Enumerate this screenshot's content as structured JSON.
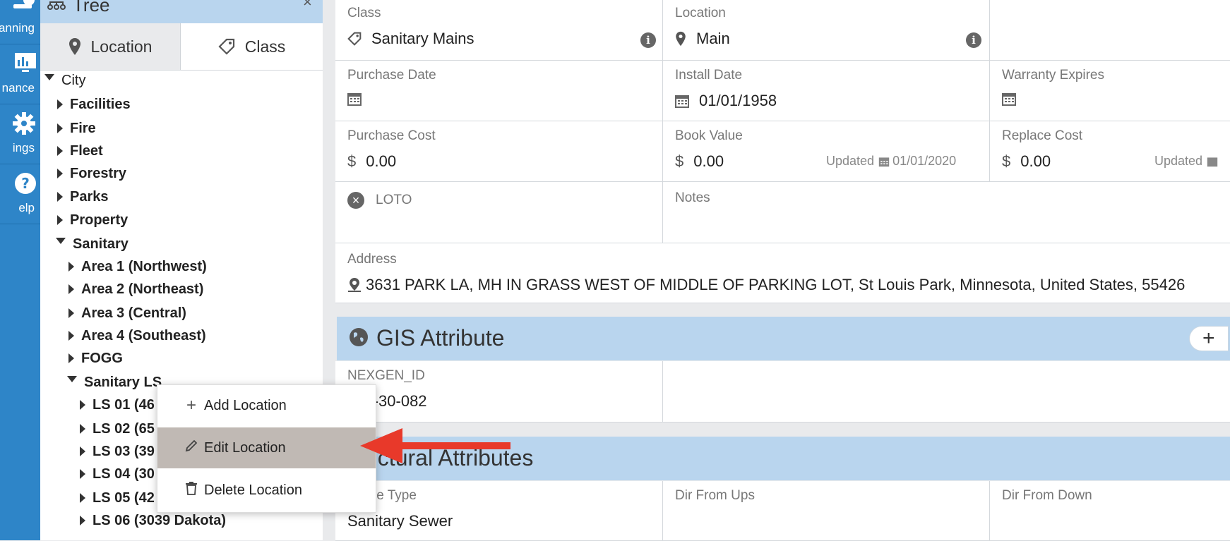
{
  "rail": {
    "items": [
      {
        "label": "anning"
      },
      {
        "label": "nance"
      },
      {
        "label": "ings"
      },
      {
        "label": "elp"
      }
    ]
  },
  "tree": {
    "title": "Tree",
    "tabs": {
      "location": "Location",
      "class": "Class"
    },
    "nodes": {
      "city": "City",
      "facilities": "Facilities",
      "fire": "Fire",
      "fleet": "Fleet",
      "forestry": "Forestry",
      "parks": "Parks",
      "property": "Property",
      "sanitary": "Sanitary",
      "area1": "Area 1 (Northwest)",
      "area2": "Area 2 (Northeast)",
      "area3": "Area 3 (Central)",
      "area4": "Area 4 (Southeast)",
      "fogg": "FOGG",
      "sanitary_ls": "Sanitary LS",
      "ls01": "LS 01 (46",
      "ls02": "LS 02 (65",
      "ls03": "LS 03 (39",
      "ls04": "LS 04 (30",
      "ls05": "LS 05 (42",
      "ls06": "LS 06 (3039 Dakota)"
    }
  },
  "context_menu": {
    "add": "Add Location",
    "edit": "Edit Location",
    "delete": "Delete Location"
  },
  "fields": {
    "class_label": "Class",
    "class_value": "Sanitary Mains",
    "location_label": "Location",
    "location_value": "Main",
    "purchase_date_label": "Purchase Date",
    "install_date_label": "Install Date",
    "install_date_value": "01/01/1958",
    "warranty_label": "Warranty Expires",
    "purchase_cost_label": "Purchase Cost",
    "purchase_cost_value": "0.00",
    "book_value_label": "Book Value",
    "book_value_value": "0.00",
    "book_updated_label": "Updated",
    "book_updated_date": "01/01/2020",
    "replace_cost_label": "Replace Cost",
    "replace_cost_value": "0.00",
    "replace_updated_label": "Updated",
    "loto_label": "LOTO",
    "notes_label": "Notes",
    "address_label": "Address",
    "address_value": "3631 PARK LA, MH IN GRASS WEST OF MIDDLE OF PARKING LOT, St Louis Park, Minnesota, United States, 55426",
    "currency_symbol": "$"
  },
  "gis": {
    "title": "GIS Attribute",
    "plus": "+",
    "nexgen_label": "NEXGEN_ID",
    "nexgen_value": "081-30-082"
  },
  "structural": {
    "title": "uctural Attributes",
    "line_type_label": "n Line Type",
    "line_type_value": "Sanitary Sewer",
    "dir_from_ups_label": "Dir From Ups",
    "dir_from_down_label": "Dir From Down"
  },
  "colors": {
    "rail": "#2e85c8",
    "section_bar": "#b9d5ee",
    "menu_highlight": "#c0b9b4",
    "arrow": "#e8392a"
  }
}
